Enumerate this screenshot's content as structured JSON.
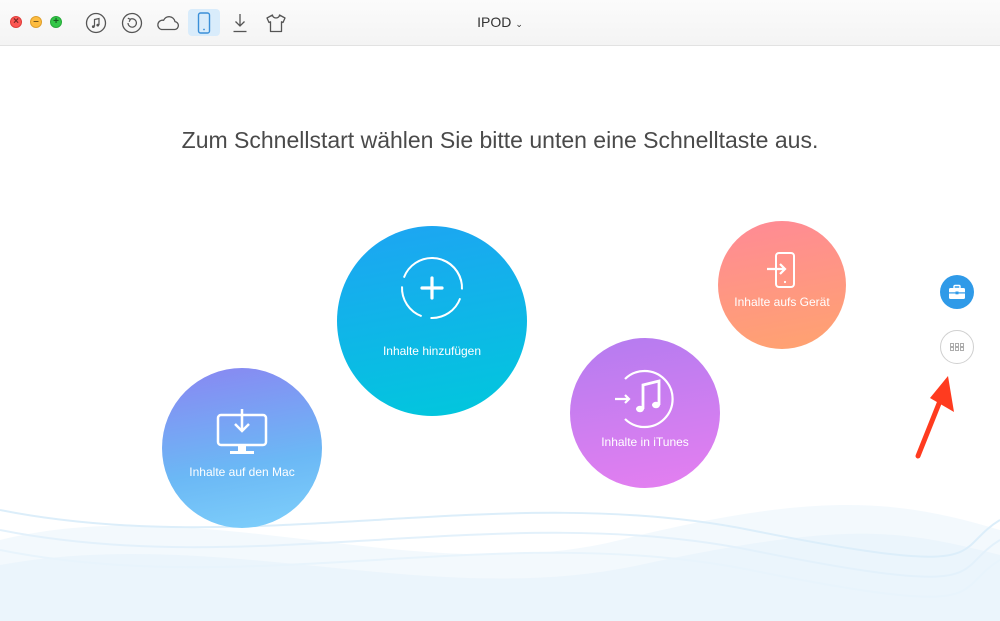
{
  "window": {
    "device_name": "IPOD"
  },
  "toolbar": {
    "items": [
      {
        "icon": "music-note-icon"
      },
      {
        "icon": "restore-icon"
      },
      {
        "icon": "cloud-icon"
      },
      {
        "icon": "device-icon",
        "active": true
      },
      {
        "icon": "download-icon"
      },
      {
        "icon": "shirt-icon"
      }
    ]
  },
  "main": {
    "headline": "Zum Schnellstart wählen Sie bitte unten eine Schnelltaste aus.",
    "actions": {
      "add": {
        "label": "Inhalte hinzufügen"
      },
      "to_mac": {
        "label": "Inhalte auf den Mac"
      },
      "to_itunes": {
        "label": "Inhalte in iTunes"
      },
      "to_device": {
        "label": "Inhalte aufs Gerät"
      }
    }
  },
  "colors": {
    "accent": "#2f9ae8",
    "add_circle": "#12b4e8",
    "mac_circle": "#7fb2f6",
    "itunes_circle": "#c87ef1",
    "device_circle": "#ff9585",
    "annotation_arrow": "#ff3b1f"
  }
}
